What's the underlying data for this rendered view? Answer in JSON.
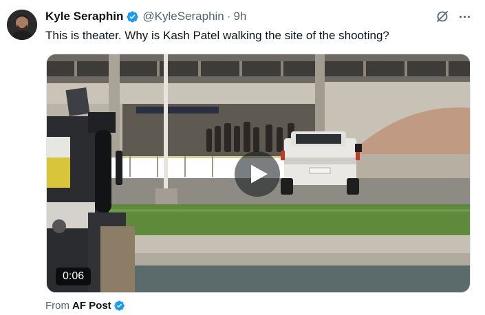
{
  "tweet": {
    "author": {
      "display_name": "Kyle Seraphin",
      "handle": "@KyleSeraphin",
      "verified": true,
      "avatar_icon": "avatar-portrait"
    },
    "separator": "·",
    "timestamp": "9h",
    "text": "This is theater. Why is Kash Patel walking the site of the shooting?",
    "media": {
      "type": "video",
      "duration": "0:06",
      "play_icon": "play-icon"
    },
    "source": {
      "label": "From",
      "name": "AF Post",
      "verified": true
    }
  },
  "icons": {
    "verified": "verified-badge-icon",
    "grok": "grok-icon",
    "more": "more-icon"
  },
  "colors": {
    "verified_blue": "#1d9bf0",
    "text_primary": "#0f1419",
    "text_secondary": "#536471"
  }
}
